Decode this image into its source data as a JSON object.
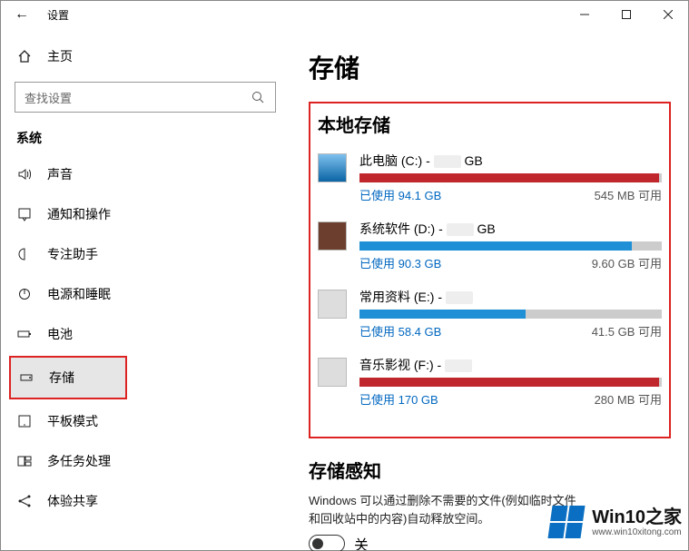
{
  "titlebar": {
    "back": "←",
    "title": "设置"
  },
  "sidebar": {
    "home": "主页",
    "search_placeholder": "查找设置",
    "section": "系统",
    "items": [
      {
        "icon": "sound-icon",
        "label": "声音"
      },
      {
        "icon": "notifications-icon",
        "label": "通知和操作"
      },
      {
        "icon": "focus-icon",
        "label": "专注助手"
      },
      {
        "icon": "power-icon",
        "label": "电源和睡眠"
      },
      {
        "icon": "battery-icon",
        "label": "电池"
      },
      {
        "icon": "storage-icon",
        "label": "存储"
      },
      {
        "icon": "tablet-icon",
        "label": "平板模式"
      },
      {
        "icon": "multitask-icon",
        "label": "多任务处理"
      },
      {
        "icon": "share-icon",
        "label": "体验共享"
      }
    ]
  },
  "main": {
    "title": "存储",
    "local_header": "本地存储",
    "drives": [
      {
        "name": "此电脑 (C:) - ",
        "size_suffix": "GB",
        "used": "已使用 94.1 GB",
        "free": "545 MB 可用",
        "fill_pct": 99,
        "color": "red",
        "icon": "win"
      },
      {
        "name": "系统软件 (D:) - ",
        "size_suffix": "GB",
        "used": "已使用 90.3 GB",
        "free": "9.60 GB 可用",
        "fill_pct": 90,
        "color": "blue",
        "icon": "avatar"
      },
      {
        "name": "常用资料 (E:) - ",
        "size_suffix": "",
        "used": "已使用 58.4 GB",
        "free": "41.5 GB 可用",
        "fill_pct": 55,
        "color": "blue",
        "icon": "disk"
      },
      {
        "name": "音乐影视 (F:) - ",
        "size_suffix": "",
        "used": "已使用 170 GB",
        "free": "280 MB 可用",
        "fill_pct": 99,
        "color": "red",
        "icon": "disk"
      }
    ],
    "sense_title": "存储感知",
    "sense_text": "Windows 可以通过删除不需要的文件(例如临时文件和回收站中的内容)自动释放空间。",
    "toggle_label": "关"
  },
  "watermark": {
    "big": "Win10之家",
    "small": "www.win10xitong.com"
  }
}
